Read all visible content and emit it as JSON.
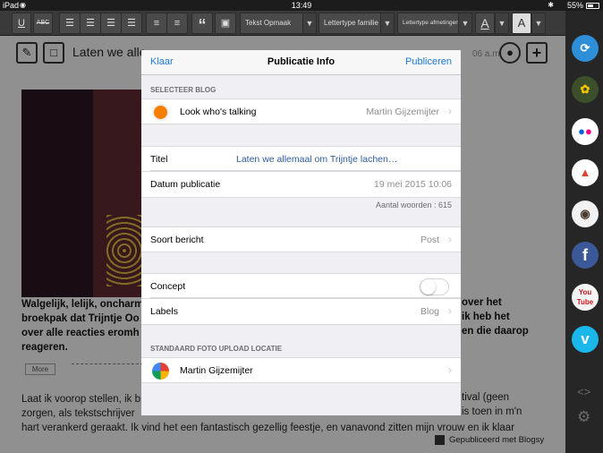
{
  "status_bar": {
    "device": "iPad",
    "time": "13:49",
    "battery": "55%"
  },
  "toolbar": {
    "u_label": "U",
    "abc_label": "ABC",
    "quote_label": "“",
    "select_style": "Tekst Opmaak",
    "select_font": "Lettertype familie",
    "select_size": "Lettertype afmetingen",
    "font_color_label": "A",
    "bg_color_label": "A"
  },
  "editor": {
    "post_title": "Laten we alle",
    "time_partial": "06 a.m.",
    "bold_left": "Walgelijk, lelijk, oncharm",
    "bold_left_2": "broekpak dat Trijntje Oo",
    "bold_left_3": "over alle reacties eromh",
    "bold_left_4": "reageren.",
    "bold_right_1": "over het",
    "bold_right_2": "ik heb het",
    "bold_right_3": "en die daarop",
    "more_label": "More",
    "para_1_left": "Laat ik voorop stellen, ik b",
    "para_1_right": "tival (geen",
    "para_2_left": "zorgen, als tekstschrijver",
    "para_2_right": "is toen in m'n",
    "para_3": "hart verankerd geraakt. Ik vind het een fantastisch gezellig feestje, en vanavond zitten mijn vrouw en ik klaar",
    "footer": "Gepubliceerd met Blogsy"
  },
  "sidebar": {
    "icons": [
      "blogsy-icon",
      "sunflower-icon",
      "flickr-icon",
      "picasa-icon",
      "instagram-icon",
      "facebook-icon",
      "youtube-icon",
      "vimeo-icon"
    ],
    "youtube_label": "You Tube",
    "vimeo_label": "v",
    "facebook_label": "f",
    "code_label": "<>"
  },
  "modal": {
    "left_button": "Klaar",
    "title": "Publicatie Info",
    "right_button": "Publiceren",
    "section_blog": "SELECTEER BLOG",
    "blog_name": "Look who's talking",
    "blog_owner": "Martin Gijzemijter",
    "title_label": "Titel",
    "title_value": "Laten we allemaal om Trijntje lachen…",
    "date_label": "Datum publicatie",
    "date_value": "19 mei 2015 10:06",
    "word_count": "Aantal woorden : 615",
    "type_label": "Soort bericht",
    "type_value": "Post",
    "concept_label": "Concept",
    "concept_on": false,
    "labels_label": "Labels",
    "labels_value": "Blog",
    "section_photo": "STANDAARD FOTO UPLOAD LOCATIE",
    "photo_account": "Martin Gijzemijter"
  },
  "colors": {
    "link_blue": "#1e7ad6",
    "blogger_orange": "#f57d00"
  }
}
